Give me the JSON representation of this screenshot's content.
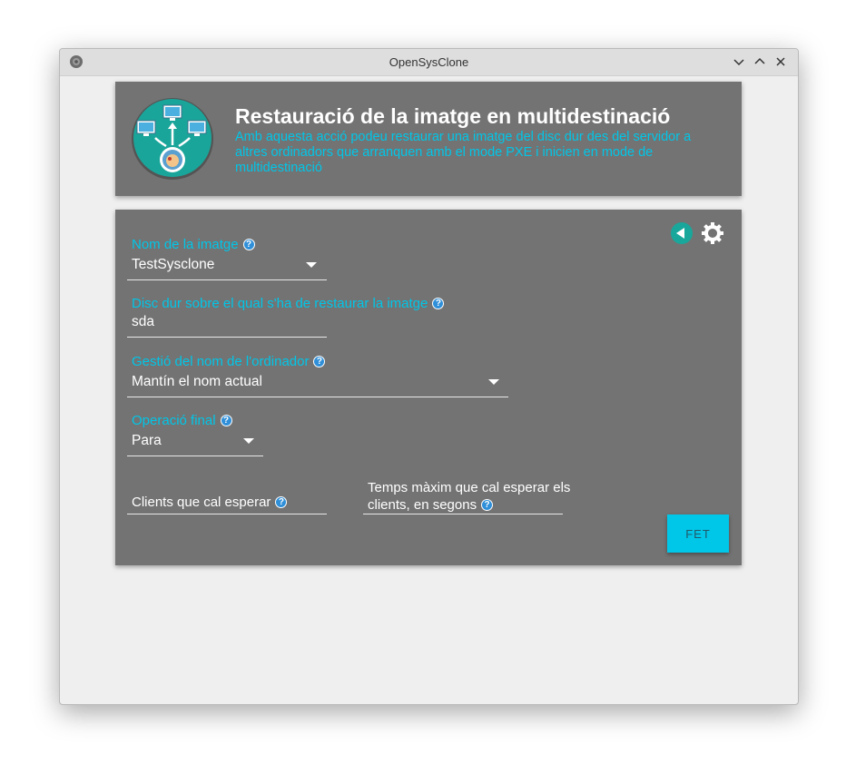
{
  "window": {
    "title": "OpenSysClone",
    "controls": [
      "chevron-down-icon",
      "chevron-up-icon",
      "close-icon"
    ]
  },
  "header": {
    "title": "Restauració de la imatge en multidestinació",
    "description": "Amb aquesta acció podeu restaurar una imatge del disc dur des del servidor a altres ordinadors que arranquen amb el mode PXE i inicien en mode de multidestinació"
  },
  "form": {
    "image_name": {
      "label": "Nom de la imatge",
      "value": "TestSysclone"
    },
    "target_disk": {
      "label": "Disc dur sobre el qual s'ha de restaurar la imatge",
      "value": "sda"
    },
    "hostname_mode": {
      "label": "Gestió del nom de l'ordinador",
      "value": "Mantín el nom actual"
    },
    "final_action": {
      "label": "Operació final",
      "value": "Para"
    },
    "clients_to_wait": {
      "label": "Clients que cal esperar",
      "value": ""
    },
    "max_wait": {
      "label_line1": "Temps màxim que cal esperar els",
      "label_line2": "clients, en segons",
      "value": ""
    },
    "submit_label": "FET"
  },
  "colors": {
    "accent": "#00c6e8",
    "card_bg": "#737373",
    "window_bg": "#efefef"
  }
}
